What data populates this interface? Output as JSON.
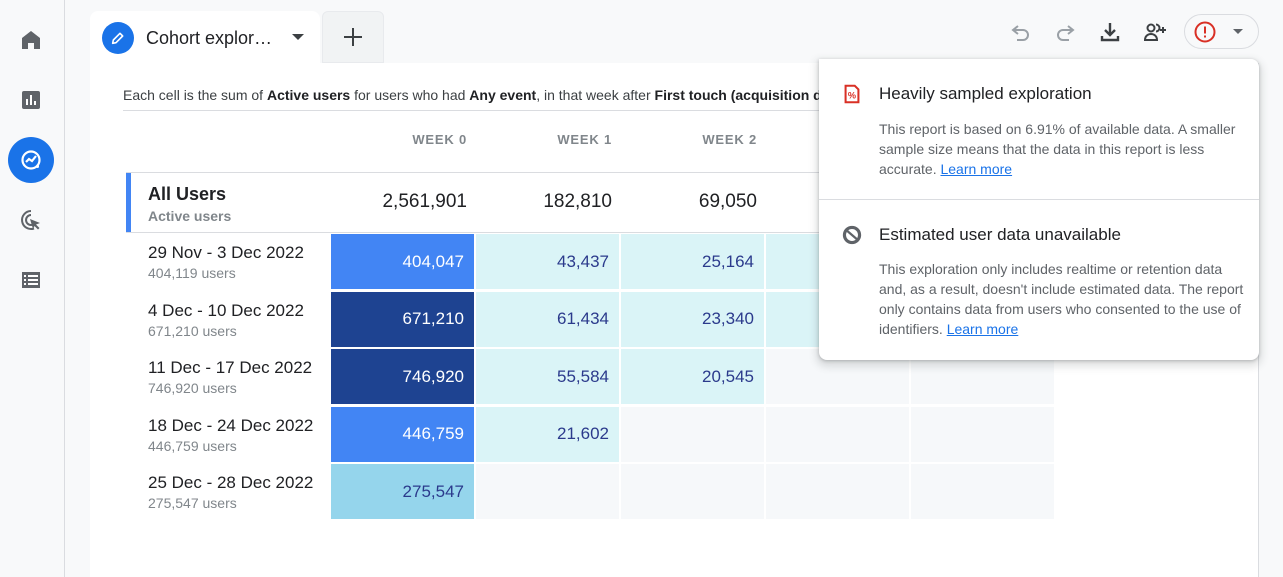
{
  "rail": {
    "items": [
      {
        "name": "home",
        "icon": "home-icon",
        "active": false
      },
      {
        "name": "reports",
        "icon": "bar-chart-icon",
        "active": false
      },
      {
        "name": "explore",
        "icon": "explore-icon",
        "active": true
      },
      {
        "name": "advertising",
        "icon": "target-cursor-icon",
        "active": false
      },
      {
        "name": "configure",
        "icon": "list-icon",
        "active": false
      }
    ]
  },
  "tab": {
    "label": "Cohort explor…",
    "icon": "pencil-icon",
    "add_icon": "plus-icon"
  },
  "toolbar": {
    "undo": "undo-icon",
    "redo": "redo-icon",
    "download": "download-icon",
    "share": "add-person-icon",
    "alert": "alert-circle-icon",
    "accent": "#d93025"
  },
  "description": {
    "p1": "Each cell is the sum of ",
    "b1": "Active users",
    "p2": " for users who had ",
    "b2": "Any event",
    "p3": ", in that week after ",
    "b3": "First touch (acquisition date)"
  },
  "table": {
    "columns": [
      "WEEK 0",
      "WEEK 1",
      "WEEK 2"
    ],
    "all_users": {
      "title": "All Users",
      "metric": "Active users",
      "values": [
        "2,561,901",
        "182,810",
        "69,050"
      ]
    },
    "rows": [
      {
        "range": "29 Nov - 3 Dec 2022",
        "users": "404,119 users",
        "cells": [
          "404,047",
          "43,437",
          "25,164",
          "",
          ""
        ]
      },
      {
        "range": "4 Dec - 10 Dec 2022",
        "users": "671,210 users",
        "cells": [
          "671,210",
          "61,434",
          "23,340",
          "",
          ""
        ]
      },
      {
        "range": "11 Dec - 17 Dec 2022",
        "users": "746,920 users",
        "cells": [
          "746,920",
          "55,584",
          "20,545",
          "",
          ""
        ]
      },
      {
        "range": "18 Dec - 24 Dec 2022",
        "users": "446,759 users",
        "cells": [
          "446,759",
          "21,602",
          "",
          "",
          ""
        ]
      },
      {
        "range": "25 Dec - 28 Dec 2022",
        "users": "275,547 users",
        "cells": [
          "275,547",
          "",
          "",
          "",
          ""
        ]
      }
    ],
    "heat": [
      [
        "blue",
        "cyan",
        "cyan",
        "cyan",
        "cyan"
      ],
      [
        "dark",
        "cyan",
        "cyan",
        "cyan",
        "empty"
      ],
      [
        "dark",
        "cyan",
        "cyan",
        "empty",
        "empty"
      ],
      [
        "blue",
        "cyan",
        "empty",
        "empty",
        "empty"
      ],
      [
        "sky",
        "empty",
        "empty",
        "empty",
        "empty"
      ]
    ]
  },
  "popup": {
    "sections": [
      {
        "icon": "sampled-percent-icon",
        "title": "Heavily sampled exploration",
        "body": "This report is based on 6.91% of available data. A smaller sample size means that the data in this report is less accurate. ",
        "link": "Learn more"
      },
      {
        "icon": "data-unavailable-icon",
        "title": "Estimated user data unavailable",
        "body": "This exploration only includes realtime or retention data and, as a result, doesn't include estimated data. The report only contains data from users who consented to the use of identifiers. ",
        "link": "Learn more"
      }
    ]
  }
}
